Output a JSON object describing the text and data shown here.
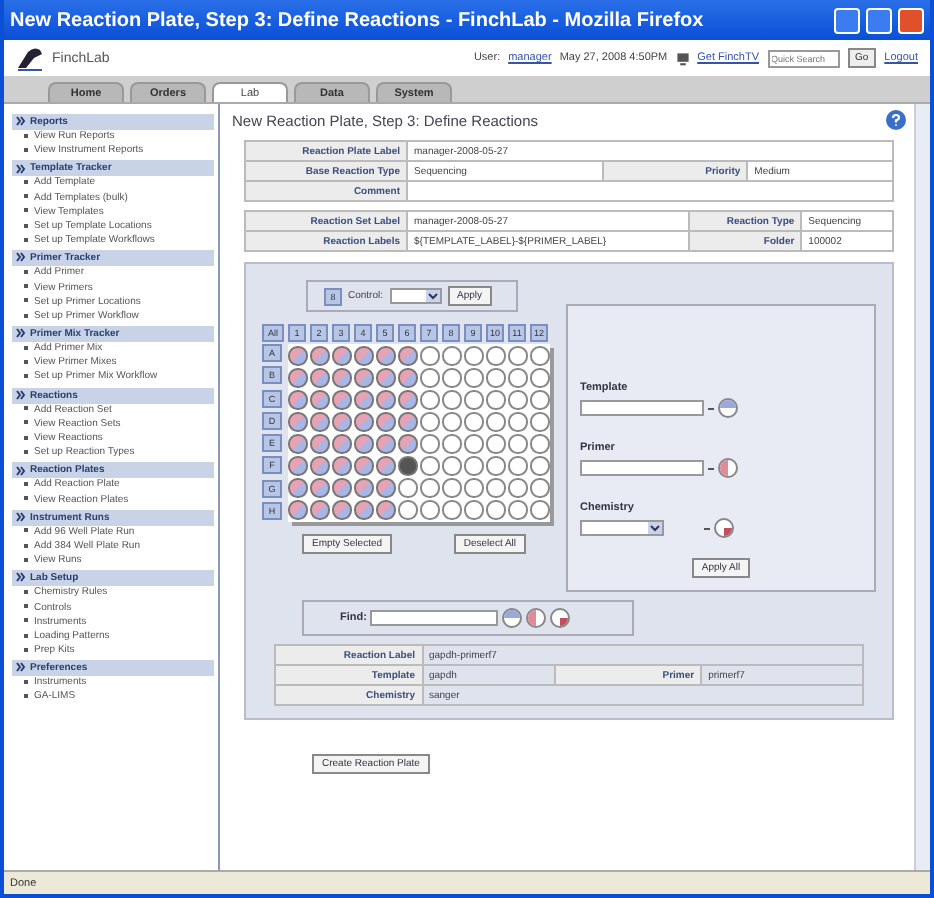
{
  "window": {
    "title": "New Reaction Plate, Step 3: Define Reactions - FinchLab - Mozilla Firefox"
  },
  "header": {
    "app_name": "FinchLab",
    "user_label": "User:",
    "user": "manager",
    "datetime": "May 27, 2008 4:50PM",
    "finchtv_link": "Get FinchTV",
    "search": {
      "placeholder": "Quick Search"
    },
    "go_button": "Go",
    "logout": "Logout"
  },
  "tabs": [
    {
      "label": "Home",
      "selected": false
    },
    {
      "label": "Orders",
      "selected": false
    },
    {
      "label": "Lab",
      "selected": true
    },
    {
      "label": "Data",
      "selected": false
    },
    {
      "label": "System",
      "selected": false
    }
  ],
  "sidebar": [
    {
      "title": "Reports",
      "items": [
        "View Run Reports",
        "View Instrument Reports"
      ]
    },
    {
      "title": "Template Tracker",
      "items": [
        "Add Template",
        "Add Templates (bulk)",
        "View Templates",
        "Set up Template Locations",
        "Set up Template Workflows"
      ]
    },
    {
      "title": "Primer Tracker",
      "items": [
        "Add Primer",
        "View Primers",
        "Set up Primer Locations",
        "Set up Primer Workflow"
      ]
    },
    {
      "title": "Primer Mix Tracker",
      "items": [
        "Add Primer Mix",
        "View Primer Mixes",
        "Set up Primer Mix Workflow"
      ]
    },
    {
      "title": "Reactions",
      "items": [
        "Add Reaction Set",
        "View Reaction Sets",
        "View Reactions",
        "Set up Reaction Types"
      ]
    },
    {
      "title": "Reaction Plates",
      "items": [
        "Add Reaction Plate",
        "View Reaction Plates"
      ]
    },
    {
      "title": "Instrument Runs",
      "items": [
        "Add 96 Well Plate Run",
        "Add 384 Well Plate Run",
        "View Runs"
      ]
    },
    {
      "title": "Lab Setup",
      "items": [
        "Chemistry Rules",
        "Controls",
        "Instruments",
        "Loading Patterns",
        "Prep Kits"
      ]
    },
    {
      "title": "Preferences",
      "items": [
        "Instruments",
        "GA-LIMS"
      ]
    }
  ],
  "page_title": "New Reaction Plate, Step 3: Define Reactions",
  "plate_info": [
    {
      "label": "Reaction Plate Label",
      "value": "manager-2008-05-27"
    },
    {
      "label": "Base Reaction Type",
      "value": "Sequencing",
      "label_2": "Priority",
      "value_2": "Medium"
    },
    {
      "label": "Comment"
    }
  ],
  "set_info": [
    {
      "label": "Reaction Set Label",
      "value": "manager-2008-05-27",
      "label_2": "Reaction Type",
      "value_2": "Sequencing"
    },
    {
      "label": "Reaction Labels",
      "value": "${TEMPLATE_LABEL}-${PRIMER_LABEL}",
      "label_2": "Folder",
      "value_2": "100002"
    }
  ],
  "control_bar": {
    "button": "8",
    "label": "Control:",
    "apply": "Apply"
  },
  "plate": {
    "all_button": "All",
    "columns": [
      "1",
      "2",
      "3",
      "4",
      "5",
      "6",
      "7",
      "8",
      "9",
      "10",
      "11",
      "12"
    ],
    "rows": [
      {
        "label": "A",
        "wells": [
          {
            "kind": "filled"
          },
          {
            "kind": "filled"
          },
          {
            "kind": "filled"
          },
          {
            "kind": "filled"
          },
          {
            "kind": "filled"
          },
          {
            "kind": "filled"
          },
          {
            "kind": "empty"
          },
          {
            "kind": "empty"
          },
          {
            "kind": "empty"
          },
          {
            "kind": "empty"
          },
          {
            "kind": "empty"
          },
          {
            "kind": "empty"
          }
        ]
      },
      {
        "label": "B",
        "wells": [
          {
            "kind": "filled"
          },
          {
            "kind": "filled"
          },
          {
            "kind": "filled"
          },
          {
            "kind": "filled"
          },
          {
            "kind": "filled"
          },
          {
            "kind": "filled"
          },
          {
            "kind": "empty"
          },
          {
            "kind": "empty"
          },
          {
            "kind": "empty"
          },
          {
            "kind": "empty"
          },
          {
            "kind": "empty"
          },
          {
            "kind": "empty"
          }
        ]
      },
      {
        "label": "C",
        "wells": [
          {
            "kind": "filled"
          },
          {
            "kind": "filled"
          },
          {
            "kind": "filled"
          },
          {
            "kind": "filled"
          },
          {
            "kind": "filled"
          },
          {
            "kind": "filled"
          },
          {
            "kind": "empty"
          },
          {
            "kind": "empty"
          },
          {
            "kind": "empty"
          },
          {
            "kind": "empty"
          },
          {
            "kind": "empty"
          },
          {
            "kind": "empty"
          }
        ]
      },
      {
        "label": "D",
        "wells": [
          {
            "kind": "filled"
          },
          {
            "kind": "filled"
          },
          {
            "kind": "filled"
          },
          {
            "kind": "filled"
          },
          {
            "kind": "filled"
          },
          {
            "kind": "filled"
          },
          {
            "kind": "empty"
          },
          {
            "kind": "empty"
          },
          {
            "kind": "empty"
          },
          {
            "kind": "empty"
          },
          {
            "kind": "empty"
          },
          {
            "kind": "empty"
          }
        ]
      },
      {
        "label": "E",
        "wells": [
          {
            "kind": "filled"
          },
          {
            "kind": "filled"
          },
          {
            "kind": "filled"
          },
          {
            "kind": "filled"
          },
          {
            "kind": "filled"
          },
          {
            "kind": "filled"
          },
          {
            "kind": "empty"
          },
          {
            "kind": "empty"
          },
          {
            "kind": "empty"
          },
          {
            "kind": "empty"
          },
          {
            "kind": "empty"
          },
          {
            "kind": "empty"
          }
        ]
      },
      {
        "label": "F",
        "wells": [
          {
            "kind": "filled"
          },
          {
            "kind": "filled"
          },
          {
            "kind": "filled"
          },
          {
            "kind": "filled"
          },
          {
            "kind": "filled"
          },
          {
            "kind": "current"
          },
          {
            "kind": "empty"
          },
          {
            "kind": "empty"
          },
          {
            "kind": "empty"
          },
          {
            "kind": "empty"
          },
          {
            "kind": "empty"
          },
          {
            "kind": "empty"
          }
        ]
      },
      {
        "label": "G",
        "wells": [
          {
            "kind": "filled"
          },
          {
            "kind": "filled"
          },
          {
            "kind": "filled"
          },
          {
            "kind": "filled"
          },
          {
            "kind": "filled"
          },
          {
            "kind": "empty"
          },
          {
            "kind": "empty"
          },
          {
            "kind": "empty"
          },
          {
            "kind": "empty"
          },
          {
            "kind": "empty"
          },
          {
            "kind": "empty"
          },
          {
            "kind": "empty"
          }
        ]
      },
      {
        "label": "H",
        "wells": [
          {
            "kind": "filled"
          },
          {
            "kind": "filled"
          },
          {
            "kind": "filled"
          },
          {
            "kind": "filled"
          },
          {
            "kind": "filled"
          },
          {
            "kind": "empty"
          },
          {
            "kind": "empty"
          },
          {
            "kind": "empty"
          },
          {
            "kind": "empty"
          },
          {
            "kind": "empty"
          },
          {
            "kind": "empty"
          },
          {
            "kind": "empty"
          }
        ]
      }
    ],
    "empty_button": "Empty Selected",
    "deselect_button": "Deselect All"
  },
  "assign": {
    "template_label": "Template",
    "primer_label": "Primer",
    "chemistry_label": "Chemistry",
    "apply_all": "Apply All"
  },
  "find": {
    "label": "Find:"
  },
  "reaction_info": [
    {
      "label": "Reaction Label",
      "value": "gapdh-primerf7"
    },
    {
      "label": "Template",
      "value": "gapdh",
      "label_2": "Primer",
      "value_2": "primerf7"
    },
    {
      "label": "Chemistry",
      "value": "sanger"
    }
  ],
  "create_button": "Create Reaction Plate",
  "status_bar": "Done"
}
